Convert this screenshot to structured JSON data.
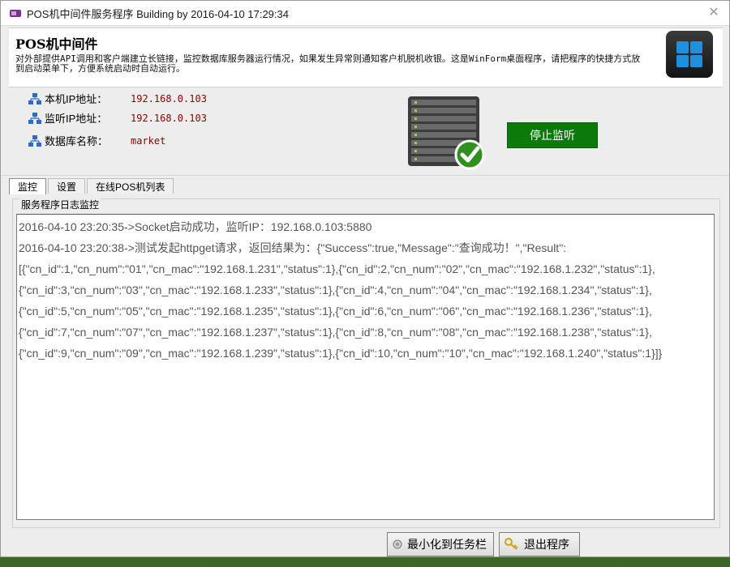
{
  "window": {
    "title": "POS机中间件服务程序 Building by 2016-04-10 17:29:34"
  },
  "banner": {
    "title": "POS机中间件",
    "description": "对外部提供API调用和客户端建立长链接，监控数据库服务器运行情况，如果发生异常则通知客户机脱机收银。这是WinForm桌面程序，请把程序的快捷方式放到启动菜单下，方便系统启动时自动运行。"
  },
  "info": {
    "local_ip_label": "本机IP地址：",
    "local_ip_value": "192.168.0.103",
    "listen_ip_label": "监听IP地址：",
    "listen_ip_value": "192.168.0.103",
    "db_name_label": "数据库名称：",
    "db_name_value": "market"
  },
  "stop_button_label": "停止监听",
  "tabs": [
    "监控",
    "设置",
    "在线POS机列表"
  ],
  "log": {
    "group_label": "服务程序日志监控",
    "lines": [
      "2016-04-10 23:20:35->Socket启动成功，监听IP：192.168.0.103:5880",
      "2016-04-10 23:20:38->测试发起httpget请求，返回结果为：{\"Success\":true,\"Message\":\"查询成功！\",\"Result\":",
      "[{\"cn_id\":1,\"cn_num\":\"01\",\"cn_mac\":\"192.168.1.231\",\"status\":1},{\"cn_id\":2,\"cn_num\":\"02\",\"cn_mac\":\"192.168.1.232\",\"status\":1},",
      "{\"cn_id\":3,\"cn_num\":\"03\",\"cn_mac\":\"192.168.1.233\",\"status\":1},{\"cn_id\":4,\"cn_num\":\"04\",\"cn_mac\":\"192.168.1.234\",\"status\":1},",
      "{\"cn_id\":5,\"cn_num\":\"05\",\"cn_mac\":\"192.168.1.235\",\"status\":1},{\"cn_id\":6,\"cn_num\":\"06\",\"cn_mac\":\"192.168.1.236\",\"status\":1},",
      "{\"cn_id\":7,\"cn_num\":\"07\",\"cn_mac\":\"192.168.1.237\",\"status\":1},{\"cn_id\":8,\"cn_num\":\"08\",\"cn_mac\":\"192.168.1.238\",\"status\":1},",
      "{\"cn_id\":9,\"cn_num\":\"09\",\"cn_mac\":\"192.168.1.239\",\"status\":1},{\"cn_id\":10,\"cn_num\":\"10\",\"cn_mac\":\"192.168.1.240\",\"status\":1}]}"
    ]
  },
  "buttons": {
    "minimize_label": "最小化到任务栏",
    "exit_label": "退出程序"
  },
  "colors": {
    "stop_button": "#0b7a0b",
    "ip_value_text": "#8b0000"
  },
  "icons": [
    "app-icon",
    "close-icon",
    "windows-logo-icon",
    "network-icon",
    "server-check-icon",
    "radio-dot-icon",
    "key-icon"
  ]
}
